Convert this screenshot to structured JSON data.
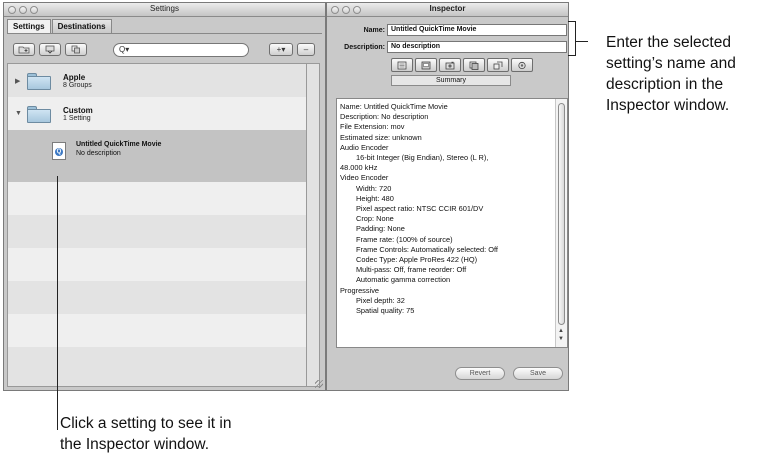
{
  "settings_window": {
    "title": "Settings",
    "tabs": [
      "Settings",
      "Destinations"
    ],
    "toolbar": {
      "add_group_icon": "folder-add-icon",
      "filter_icon": "filter-icon",
      "duplicate_icon": "duplicate-icon",
      "search_placeholder": "Q▾",
      "add_label": "+▾",
      "remove_label": "–"
    },
    "groups": [
      {
        "name": "Apple",
        "sub": "8 Groups",
        "expanded": false
      },
      {
        "name": "Custom",
        "sub": "1 Setting",
        "expanded": true
      }
    ],
    "setting": {
      "name": "Untitled QuickTime Movie",
      "sub": "No description",
      "icon": "quicktime-document-icon"
    }
  },
  "inspector_window": {
    "title": "Inspector",
    "name_label": "Name:",
    "name_value": "Untitled QuickTime Movie",
    "description_label": "Description:",
    "description_value": "No description",
    "tab_icons": [
      "summary-icon",
      "encoder-icon",
      "frame-controls-icon",
      "filters-icon",
      "geometry-icon",
      "actions-icon"
    ],
    "summary_tab": "Summary",
    "summary_lines": [
      {
        "text": "Name: Untitled QuickTime Movie",
        "indent": 0
      },
      {
        "text": "Description: No description",
        "indent": 0
      },
      {
        "text": "File Extension: mov",
        "indent": 0
      },
      {
        "text": "Estimated size: unknown",
        "indent": 0
      },
      {
        "text": "Audio Encoder",
        "indent": 0
      },
      {
        "text": "16-bit Integer (Big Endian), Stereo (L R),",
        "indent": 1
      },
      {
        "text": "48.000 kHz",
        "indent": 0
      },
      {
        "text": "Video Encoder",
        "indent": 0
      },
      {
        "text": "Width: 720",
        "indent": 1
      },
      {
        "text": "Height: 480",
        "indent": 1
      },
      {
        "text": "Pixel aspect ratio: NTSC CCIR 601/DV",
        "indent": 1
      },
      {
        "text": "Crop: None",
        "indent": 1
      },
      {
        "text": "Padding: None",
        "indent": 1
      },
      {
        "text": "Frame rate: (100% of source)",
        "indent": 1
      },
      {
        "text": "Frame Controls: Automatically selected: Off",
        "indent": 1
      },
      {
        "text": "Codec Type: Apple ProRes 422 (HQ)",
        "indent": 1
      },
      {
        "text": "Multi-pass: Off, frame reorder: Off",
        "indent": 1
      },
      {
        "text": "Automatic gamma correction",
        "indent": 1
      },
      {
        "text": "Progressive",
        "indent": 0
      },
      {
        "text": "Pixel depth: 32",
        "indent": 1
      },
      {
        "text": "Spatial quality: 75",
        "indent": 1
      }
    ],
    "revert_label": "Revert",
    "save_label": "Save"
  },
  "callouts": {
    "right": "Enter the selected setting's name and description in the Inspector window.",
    "right_lines": [
      "Enter the selected",
      "setting’s name and",
      "description in the",
      "Inspector window."
    ],
    "bottom_lines": [
      "Click a setting to see it in",
      "the Inspector window."
    ]
  }
}
